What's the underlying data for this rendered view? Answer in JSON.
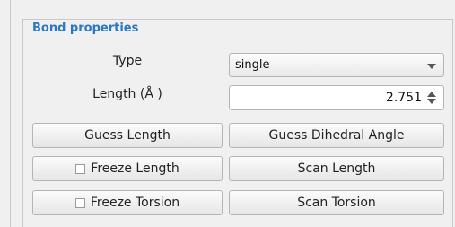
{
  "group": {
    "title": "Bond properties"
  },
  "type_row": {
    "label": "Type",
    "selected": "single"
  },
  "length_row": {
    "label": "Length (Å )",
    "value": "2.751"
  },
  "buttons": {
    "guess_length": "Guess Length",
    "guess_dihedral": "Guess Dihedral Angle",
    "freeze_length": "Freeze Length",
    "scan_length": "Scan Length",
    "freeze_torsion": "Freeze Torsion",
    "scan_torsion": "Scan Torsion"
  }
}
